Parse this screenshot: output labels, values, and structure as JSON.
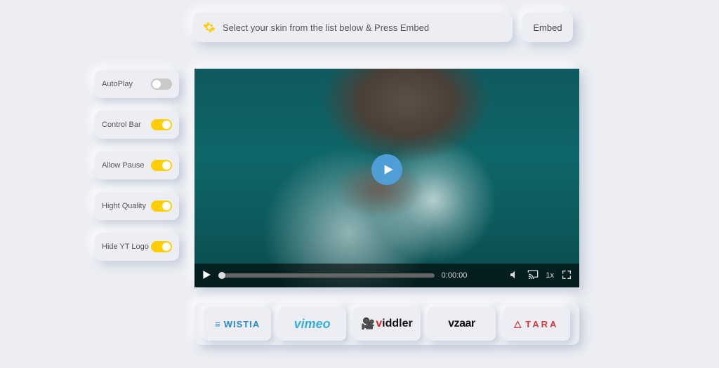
{
  "topbar": {
    "instruction_text": "Select your skin from the list below & Press Embed",
    "embed_label": "Embed"
  },
  "toggles": [
    {
      "label": "AutoPlay",
      "state": "off"
    },
    {
      "label": "Control Bar",
      "state": "on"
    },
    {
      "label": "Allow Pause",
      "state": "on"
    },
    {
      "label": "Hight Quality",
      "state": "on"
    },
    {
      "label": "Hide YT Logo",
      "state": "on"
    }
  ],
  "player": {
    "current_time": "0:00:00",
    "speed_label": "1x"
  },
  "providers": [
    {
      "id": "wistia",
      "display": "WISTIA"
    },
    {
      "id": "vimeo",
      "display": "vimeo"
    },
    {
      "id": "viddler",
      "display": "iddler"
    },
    {
      "id": "vzaar",
      "display": "vzaar"
    },
    {
      "id": "tara",
      "display": "TARA"
    }
  ]
}
